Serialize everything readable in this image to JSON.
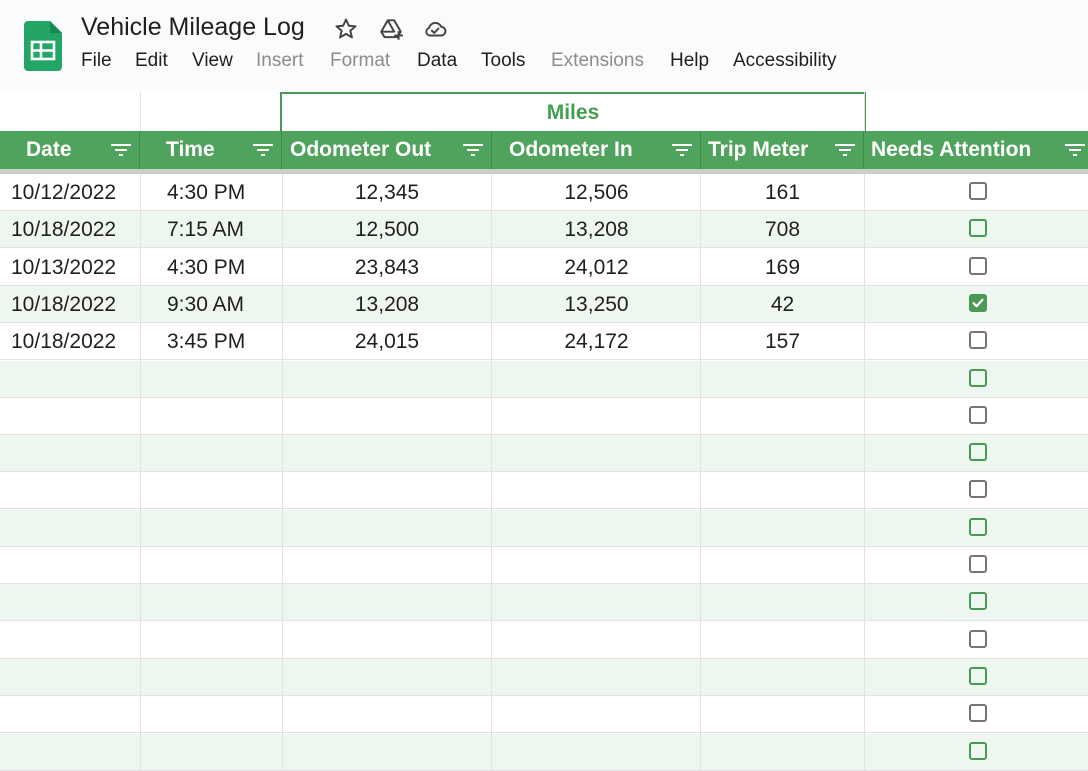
{
  "doc": {
    "title": "Vehicle Mileage Log"
  },
  "menu": [
    "File",
    "Edit",
    "View",
    "Insert",
    "Format",
    "Data",
    "Tools",
    "Extensions",
    "Help",
    "Accessibility"
  ],
  "menu_disabled": [
    "Insert",
    "Format",
    "Extensions"
  ],
  "group_header": "Miles",
  "columns": [
    "Date",
    "Time",
    "Odometer Out",
    "Odometer In",
    "Trip Meter",
    "Needs Attention"
  ],
  "rows": [
    {
      "date": "10/12/2022",
      "time": "4:30 PM",
      "odometer_out": "12,345",
      "odometer_in": "12,506",
      "trip_meter": "161",
      "needs_attention": false
    },
    {
      "date": "10/18/2022",
      "time": "7:15 AM",
      "odometer_out": "12,500",
      "odometer_in": "13,208",
      "trip_meter": "708",
      "needs_attention": false
    },
    {
      "date": "10/13/2022",
      "time": "4:30 PM",
      "odometer_out": "23,843",
      "odometer_in": "24,012",
      "trip_meter": "169",
      "needs_attention": false
    },
    {
      "date": "10/18/2022",
      "time": "9:30 AM",
      "odometer_out": "13,208",
      "odometer_in": "13,250",
      "trip_meter": "42",
      "needs_attention": true
    },
    {
      "date": "10/18/2022",
      "time": "3:45 PM",
      "odometer_out": "24,015",
      "odometer_in": "24,172",
      "trip_meter": "157",
      "needs_attention": false
    }
  ],
  "empty_rows": 11,
  "colors": {
    "header_green": "#50a35c",
    "accent_green": "#4a9a55",
    "band_green": "#edf7ef"
  }
}
